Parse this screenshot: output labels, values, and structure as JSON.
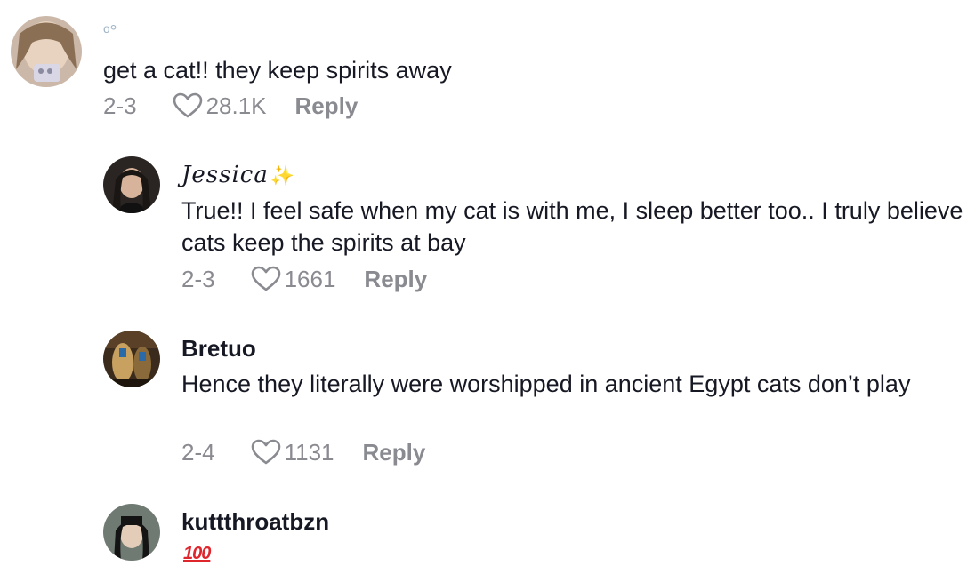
{
  "comments": [
    {
      "username": "",
      "text": "get a cat!! they keep spirits away",
      "date": "2-3",
      "likes": "28.1K",
      "reply_label": "Reply"
    },
    {
      "username": "Jessica",
      "username_suffix": "✨",
      "text": "True!! I feel safe when my cat is with me, I sleep better too.. I truly believe cats keep the spirits at bay",
      "date": "2-3",
      "likes": "1661",
      "reply_label": "Reply"
    },
    {
      "username": "Bretuo",
      "text": "Hence they literally were worshipped in ancient Egypt cats don’t play",
      "date": "2-4",
      "likes": "1131",
      "reply_label": "Reply"
    },
    {
      "username": "kuttthroatbzn",
      "text": "💯",
      "emoji_label": "100"
    }
  ]
}
